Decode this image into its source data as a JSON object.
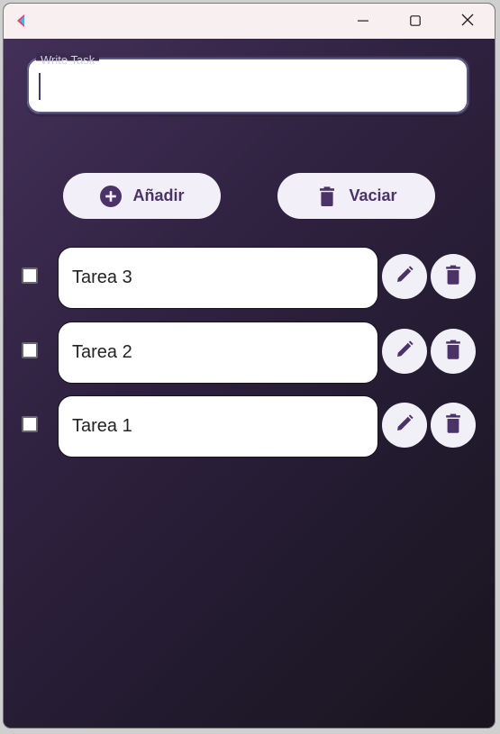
{
  "window": {
    "controls": {
      "minimize": "minimize-icon",
      "maximize": "maximize-icon",
      "close": "close-icon"
    }
  },
  "input": {
    "label": "Write Task",
    "value": "",
    "placeholder": ""
  },
  "actions": {
    "add_label": "Añadir",
    "clear_label": "Vaciar",
    "add_icon": "plus-circle-icon",
    "clear_icon": "trash-icon"
  },
  "tasks": [
    {
      "label": "Tarea 3",
      "checked": false
    },
    {
      "label": "Tarea 2",
      "checked": false
    },
    {
      "label": "Tarea 1",
      "checked": false
    }
  ],
  "colors": {
    "accent": "#4b3368",
    "background_start": "#443058",
    "background_end": "#19141f",
    "surface": "#ffffff",
    "button_bg": "#f2eff8"
  }
}
